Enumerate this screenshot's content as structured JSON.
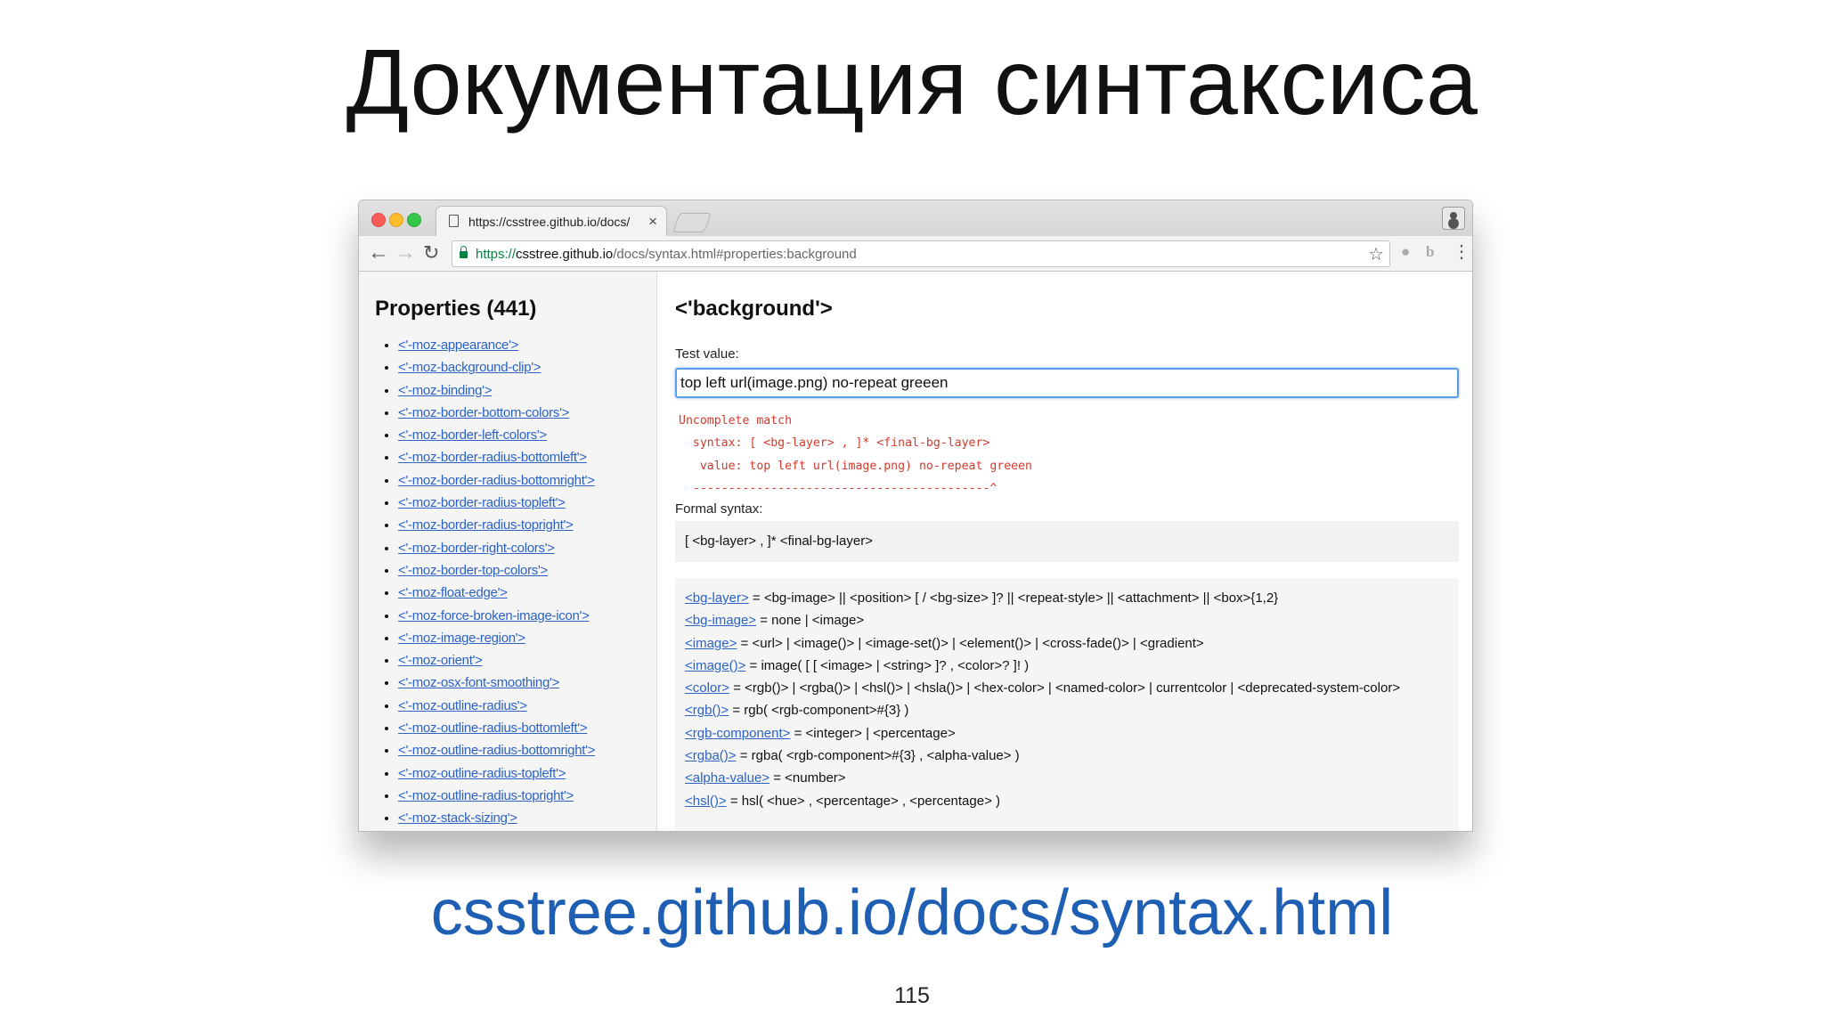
{
  "slide": {
    "title": "Документация синтаксиса",
    "link": "csstree.github.io/docs/syntax.html",
    "page_number": "115"
  },
  "browser": {
    "tab_title": "https://csstree.github.io/docs/",
    "tab_close": "×",
    "url_scheme": "https://",
    "url_host": "csstree.github.io",
    "url_path": "/docs/syntax.html#properties:background",
    "colors": {
      "traffic_red": "#fc5b57",
      "traffic_yellow": "#fdbc2e",
      "traffic_green": "#34c748",
      "secure": "#0b8043",
      "link": "#2b62c6",
      "error": "#d33a2c",
      "focus": "#5b9ee8"
    },
    "icons": {
      "back": "←",
      "forward": "→",
      "reload": "↻",
      "star": "☆",
      "ext_1": "●",
      "ext_2": "b",
      "menu": "⋮"
    }
  },
  "sidebar": {
    "title": "Properties (441)",
    "items": [
      "<'-moz-appearance'>",
      "<'-moz-background-clip'>",
      "<'-moz-binding'>",
      "<'-moz-border-bottom-colors'>",
      "<'-moz-border-left-colors'>",
      "<'-moz-border-radius-bottomleft'>",
      "<'-moz-border-radius-bottomright'>",
      "<'-moz-border-radius-topleft'>",
      "<'-moz-border-radius-topright'>",
      "<'-moz-border-right-colors'>",
      "<'-moz-border-top-colors'>",
      "<'-moz-float-edge'>",
      "<'-moz-force-broken-image-icon'>",
      "<'-moz-image-region'>",
      "<'-moz-orient'>",
      "<'-moz-osx-font-smoothing'>",
      "<'-moz-outline-radius'>",
      "<'-moz-outline-radius-bottomleft'>",
      "<'-moz-outline-radius-bottomright'>",
      "<'-moz-outline-radius-topleft'>",
      "<'-moz-outline-radius-topright'>",
      "<'-moz-stack-sizing'>"
    ]
  },
  "main": {
    "heading": "<'background'>",
    "test_label": "Test value:",
    "test_value": "top left url(image.png) no-repeat greeen",
    "error_lines": [
      "Uncomplete match",
      "  syntax: [ <bg-layer> , ]* <final-bg-layer>",
      "   value: top left url(image.png) no-repeat greeen",
      "  ------------------------------------------^"
    ],
    "formal_label": "Formal syntax:",
    "formal_syntax": "[ <bg-layer> , ]* <final-bg-layer>",
    "definitions": [
      {
        "name": "<bg-layer>",
        "value": " = <bg-image> || <position> [ / <bg-size> ]? || <repeat-style> || <attachment> || <box>{1,2}"
      },
      {
        "name": "<bg-image>",
        "value": " = none | <image>"
      },
      {
        "name": "<image>",
        "value": " = <url> | <image()> | <image-set()> | <element()> | <cross-fade()> | <gradient>"
      },
      {
        "name": "<image()>",
        "value": " = image( [ [ <image> | <string> ]? , <color>? ]! )"
      },
      {
        "name": "<color>",
        "value": " = <rgb()> | <rgba()> | <hsl()> | <hsla()> | <hex-color> | <named-color> | currentcolor | <deprecated-system-color>"
      },
      {
        "name": "<rgb()>",
        "value": " = rgb( <rgb-component>#{3} )"
      },
      {
        "name": "<rgb-component>",
        "value": " = <integer> | <percentage>"
      },
      {
        "name": "<rgba()>",
        "value": " = rgba( <rgb-component>#{3} , <alpha-value> )"
      },
      {
        "name": "<alpha-value>",
        "value": " = <number>"
      },
      {
        "name": "<hsl()>",
        "value": " = hsl( <hue> , <percentage> , <percentage> )"
      }
    ]
  }
}
